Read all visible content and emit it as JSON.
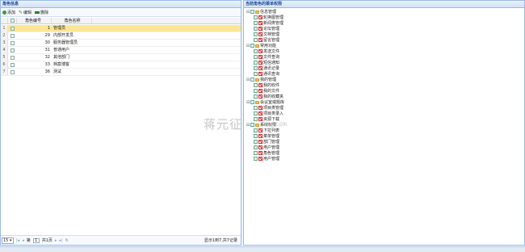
{
  "left_panel": {
    "title": "角色信息",
    "toolbar": {
      "add_label": "添加",
      "edit_label": "编辑",
      "delete_label": "删除"
    },
    "columns": {
      "code": "角色编号",
      "name": "角色名称"
    },
    "rows": [
      {
        "index": "1",
        "code": "1",
        "name": "管理员",
        "selected": true
      },
      {
        "index": "2",
        "code": "29",
        "name": "内部开发员",
        "selected": false
      },
      {
        "index": "3",
        "code": "30",
        "name": "服务器管理员",
        "selected": false
      },
      {
        "index": "4",
        "code": "31",
        "name": "普通用户",
        "selected": false
      },
      {
        "index": "5",
        "code": "32",
        "name": "其他部门",
        "selected": false
      },
      {
        "index": "6",
        "code": "33",
        "name": "档案博客",
        "selected": false
      },
      {
        "index": "7",
        "code": "36",
        "name": "测试",
        "selected": false
      }
    ],
    "pager": {
      "page_size": "15",
      "page_prefix": "第",
      "page_value": "1",
      "page_suffix": "共1页",
      "info": "显示1到7,共7记录"
    }
  },
  "right_panel": {
    "title": "当前角色的菜单权限",
    "tree": [
      {
        "label": "信息管理",
        "level": 0,
        "type": "folder"
      },
      {
        "label": "轮换图管理",
        "level": 1,
        "type": "leaf"
      },
      {
        "label": "新闻类管理",
        "level": 1,
        "type": "leaf"
      },
      {
        "label": "论坛管理",
        "level": 1,
        "type": "leaf"
      },
      {
        "label": "文档管理",
        "level": 1,
        "type": "leaf"
      },
      {
        "label": "留言管理",
        "level": 1,
        "type": "leaf"
      },
      {
        "label": "常用功能",
        "level": 0,
        "type": "folder"
      },
      {
        "label": "发送文件",
        "level": 1,
        "type": "leaf"
      },
      {
        "label": "文件查询",
        "level": 1,
        "type": "leaf"
      },
      {
        "label": "短信通知",
        "level": 1,
        "type": "leaf"
      },
      {
        "label": "通讯记录",
        "level": 1,
        "type": "leaf"
      },
      {
        "label": "通讯查询",
        "level": 1,
        "type": "leaf"
      },
      {
        "label": "我的管理",
        "level": 0,
        "type": "folder"
      },
      {
        "label": "我的收件",
        "level": 1,
        "type": "leaf"
      },
      {
        "label": "我的文件",
        "level": 1,
        "type": "leaf"
      },
      {
        "label": "我的收藏夹",
        "level": 1,
        "type": "leaf"
      },
      {
        "label": "会议室或题库",
        "level": 0,
        "type": "folder"
      },
      {
        "label": "项目类管理",
        "level": 1,
        "type": "leaf"
      },
      {
        "label": "项目类录入",
        "level": 1,
        "type": "leaf"
      },
      {
        "label": "资源下载",
        "level": 1,
        "type": "leaf"
      },
      {
        "label": "系统权限",
        "level": 0,
        "type": "folder"
      },
      {
        "label": "下拉列表",
        "level": 1,
        "type": "leaf"
      },
      {
        "label": "菜单管理",
        "level": 1,
        "type": "leaf"
      },
      {
        "label": "部门管理",
        "level": 1,
        "type": "leaf"
      },
      {
        "label": "用户管理",
        "level": 1,
        "type": "leaf"
      },
      {
        "label": "角色管理",
        "level": 1,
        "type": "leaf"
      },
      {
        "label": "用户管理",
        "level": 1,
        "type": "leaf"
      }
    ]
  },
  "watermark": {
    "text1": "蒋元征",
    "text2": "ma.com"
  },
  "icons": {
    "add": "add-icon",
    "edit": "pencil-icon",
    "delete": "delete-icon",
    "refresh": "refresh-icon"
  },
  "colors": {
    "selected_row": "#fbe694",
    "panel_border": "#99bbe8",
    "header_text": "#15428b"
  }
}
